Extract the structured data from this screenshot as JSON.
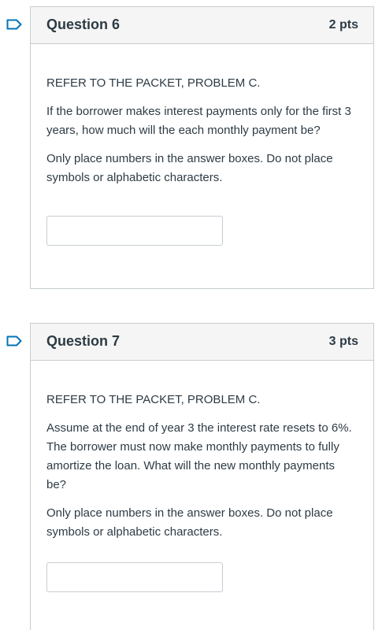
{
  "accent_color": "#0374b5",
  "questions": [
    {
      "title": "Question 6",
      "points": "2 pts",
      "paragraphs": [
        "REFER TO THE PACKET, PROBLEM C.",
        "If the borrower makes interest payments only for the first 3 years, how much will the each monthly payment be?",
        "Only place numbers in the answer boxes.  Do not place symbols or alphabetic characters."
      ],
      "answer_value": "",
      "flag_icon": "bookmark-flag-icon"
    },
    {
      "title": "Question 7",
      "points": "3 pts",
      "paragraphs": [
        "REFER TO THE PACKET, PROBLEM C.",
        "Assume at the end of year 3 the interest rate resets to 6%.  The borrower must now make monthly payments to fully amortize the loan.  What will the new monthly payments be?",
        "Only place numbers in the answer boxes.  Do not place symbols or alphabetic characters."
      ],
      "answer_value": "",
      "flag_icon": "bookmark-flag-icon"
    }
  ]
}
